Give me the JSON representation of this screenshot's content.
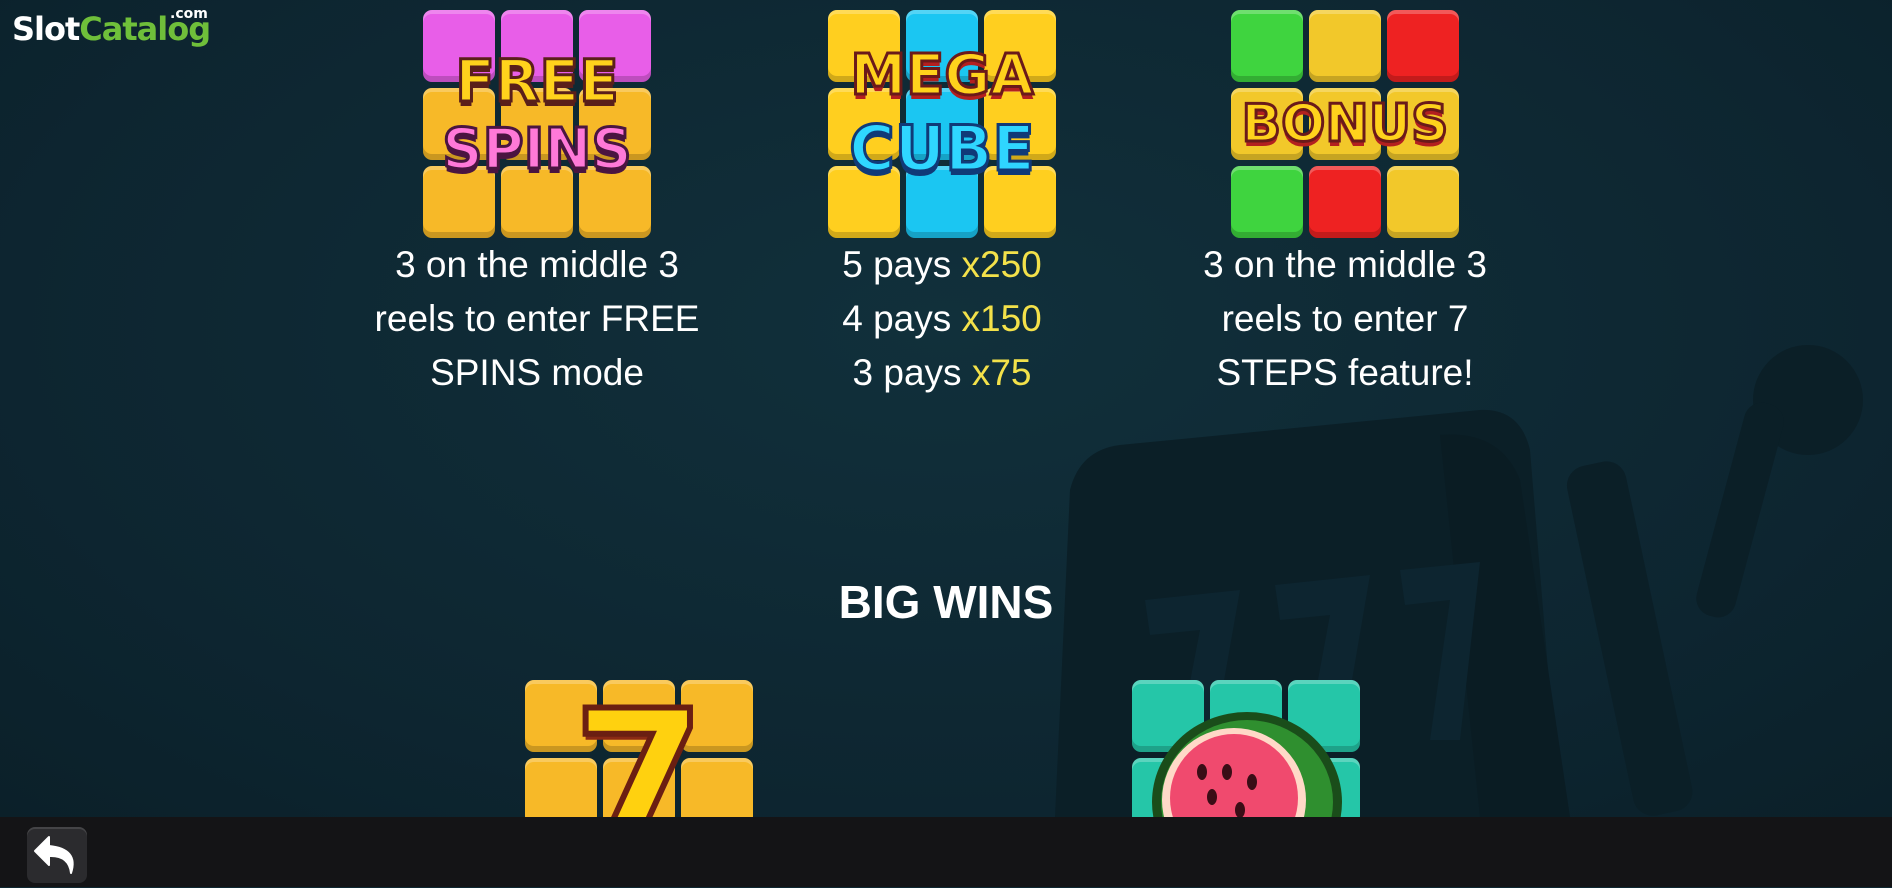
{
  "watermark": {
    "slot": "Slot",
    "catalog": "Catalog",
    "com": ".com"
  },
  "symbols": [
    {
      "name": "free-spins",
      "label_line1": "FREE",
      "label_line2": "SPINS",
      "description": [
        "3 on the middle 3",
        "reels to enter FREE",
        "SPINS mode"
      ]
    },
    {
      "name": "mega-cube",
      "label_line1": "MEGA",
      "label_line2": "CUBE",
      "pays": [
        {
          "text": "5 pays ",
          "mult": "x250"
        },
        {
          "text": "4 pays ",
          "mult": "x150"
        },
        {
          "text": "3 pays ",
          "mult": "x75"
        }
      ]
    },
    {
      "name": "bonus",
      "label_line1": "BONUS",
      "description": [
        "3 on the middle 3",
        "reels to enter 7",
        "STEPS feature!"
      ]
    }
  ],
  "big_wins_heading": "BIG WINS",
  "big_win_symbols": [
    {
      "name": "seven",
      "glyph": "7"
    },
    {
      "name": "watermelon"
    }
  ],
  "colors": {
    "background": "#0f2832",
    "highlight": "#f3e14a",
    "bottom_bar": "#141416"
  },
  "icons": {
    "back": "back-arrow-icon"
  }
}
